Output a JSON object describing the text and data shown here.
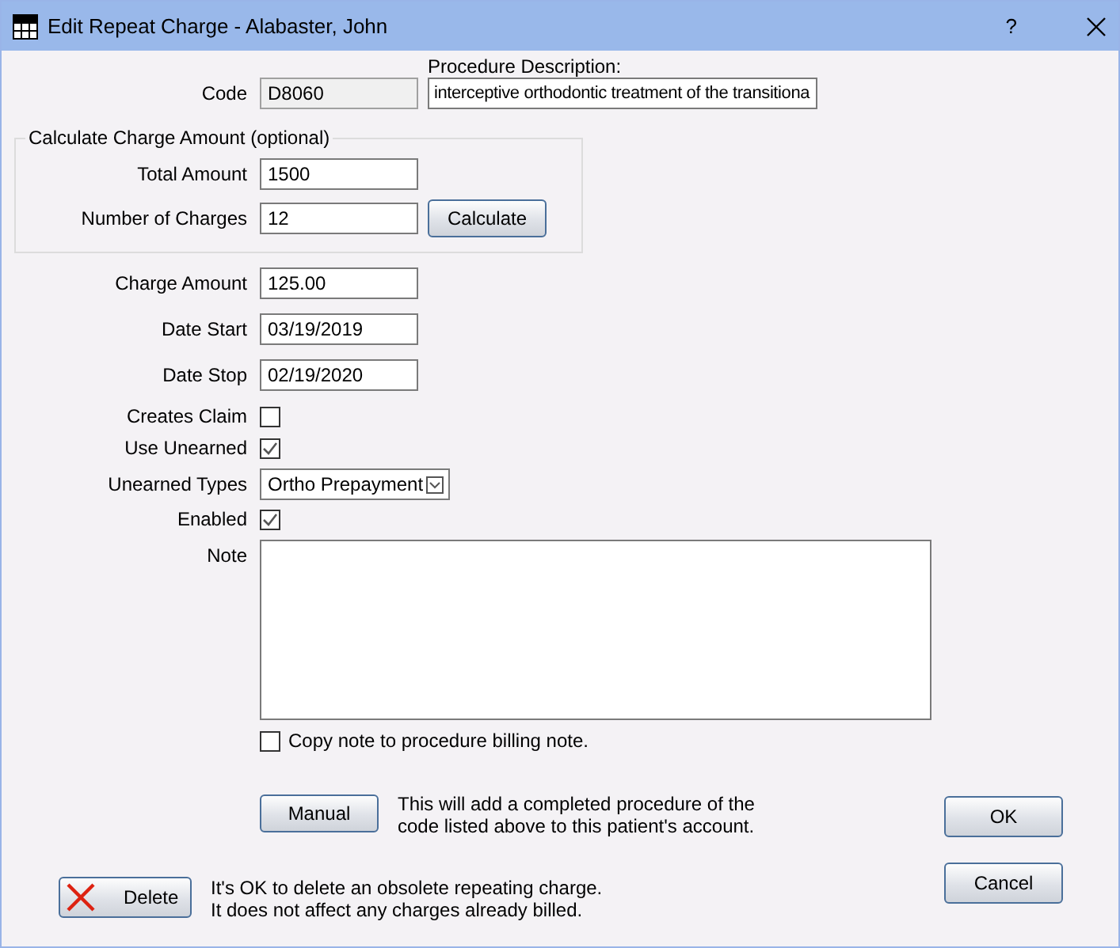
{
  "window": {
    "title": "Edit Repeat Charge - Alabaster, John",
    "help": "?"
  },
  "code": {
    "label": "Code",
    "value": "D8060",
    "disabled": true
  },
  "procedure_description": {
    "label": "Procedure Description:",
    "value": "interceptive orthodontic treatment of the transitiona"
  },
  "calculate_group": {
    "legend": "Calculate Charge Amount (optional)",
    "fields": [
      {
        "label": "Total Amount",
        "value": "1500"
      },
      {
        "label": "Number of Charges",
        "value": "12"
      }
    ],
    "button": "Calculate"
  },
  "rows": [
    {
      "kind": "text",
      "label": "Charge Amount",
      "value": "125.00"
    },
    {
      "kind": "text",
      "label": "Date Start",
      "value": "03/19/2019"
    },
    {
      "kind": "text",
      "label": "Date Stop",
      "value": "02/19/2020"
    },
    {
      "kind": "checkbox",
      "label": "Creates Claim",
      "checked": false
    },
    {
      "kind": "checkbox",
      "label": "Use Unearned",
      "checked": true
    },
    {
      "kind": "combo",
      "label": "Unearned Types",
      "value": "Ortho Prepayment"
    },
    {
      "kind": "checkbox",
      "label": "Enabled",
      "checked": true
    }
  ],
  "note": {
    "label": "Note"
  },
  "copy_note": {
    "label": "Copy note to procedure billing note.",
    "checked": false
  },
  "manual": {
    "button": "Manual",
    "text": "This will add a completed procedure of the\ncode listed above to this patient's account."
  },
  "delete": {
    "button": "Delete",
    "text": "It's OK to delete an obsolete repeating charge.\nIt does not affect any charges already billed."
  },
  "buttons": [
    "OK",
    "Cancel"
  ]
}
